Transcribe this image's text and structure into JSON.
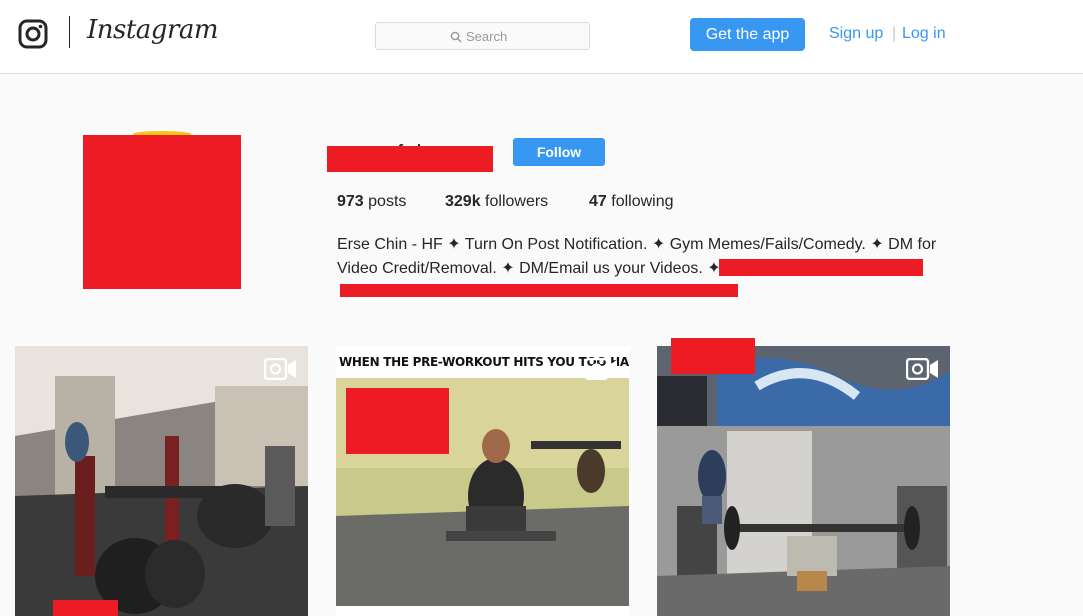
{
  "nav": {
    "logo_icon": "instagram-camera-icon",
    "wordmark": "Instagram",
    "search_placeholder": "Search",
    "search_icon": "search-icon",
    "get_app_label": "Get the app",
    "signup_label": "Sign up",
    "separator": "|",
    "login_label": "Log in"
  },
  "profile": {
    "username_visible": "f d",
    "follow_label": "Follow",
    "stats": {
      "posts_count": "973",
      "posts_label": "posts",
      "followers_count": "329k",
      "followers_label": "followers",
      "following_count": "47",
      "following_label": "following"
    },
    "bio": "Erse Chin - HF ✦ Turn On Post Notification. ✦ Gym Memes/Fails/Comedy. ✦ DM for Video Credit/Removal. ✦ DM/Email us your Videos. ✦"
  },
  "posts": [
    {
      "type": "video",
      "icon": "video-icon"
    },
    {
      "type": "video",
      "icon": "video-icon",
      "caption": "WHEN THE PRE-WORKOUT HITS YOU TOO HARD"
    },
    {
      "type": "video",
      "icon": "video-icon"
    }
  ],
  "colors": {
    "accent": "#3897f0",
    "redaction": "#ed1c24",
    "text": "#262626",
    "background": "#fafafa"
  }
}
